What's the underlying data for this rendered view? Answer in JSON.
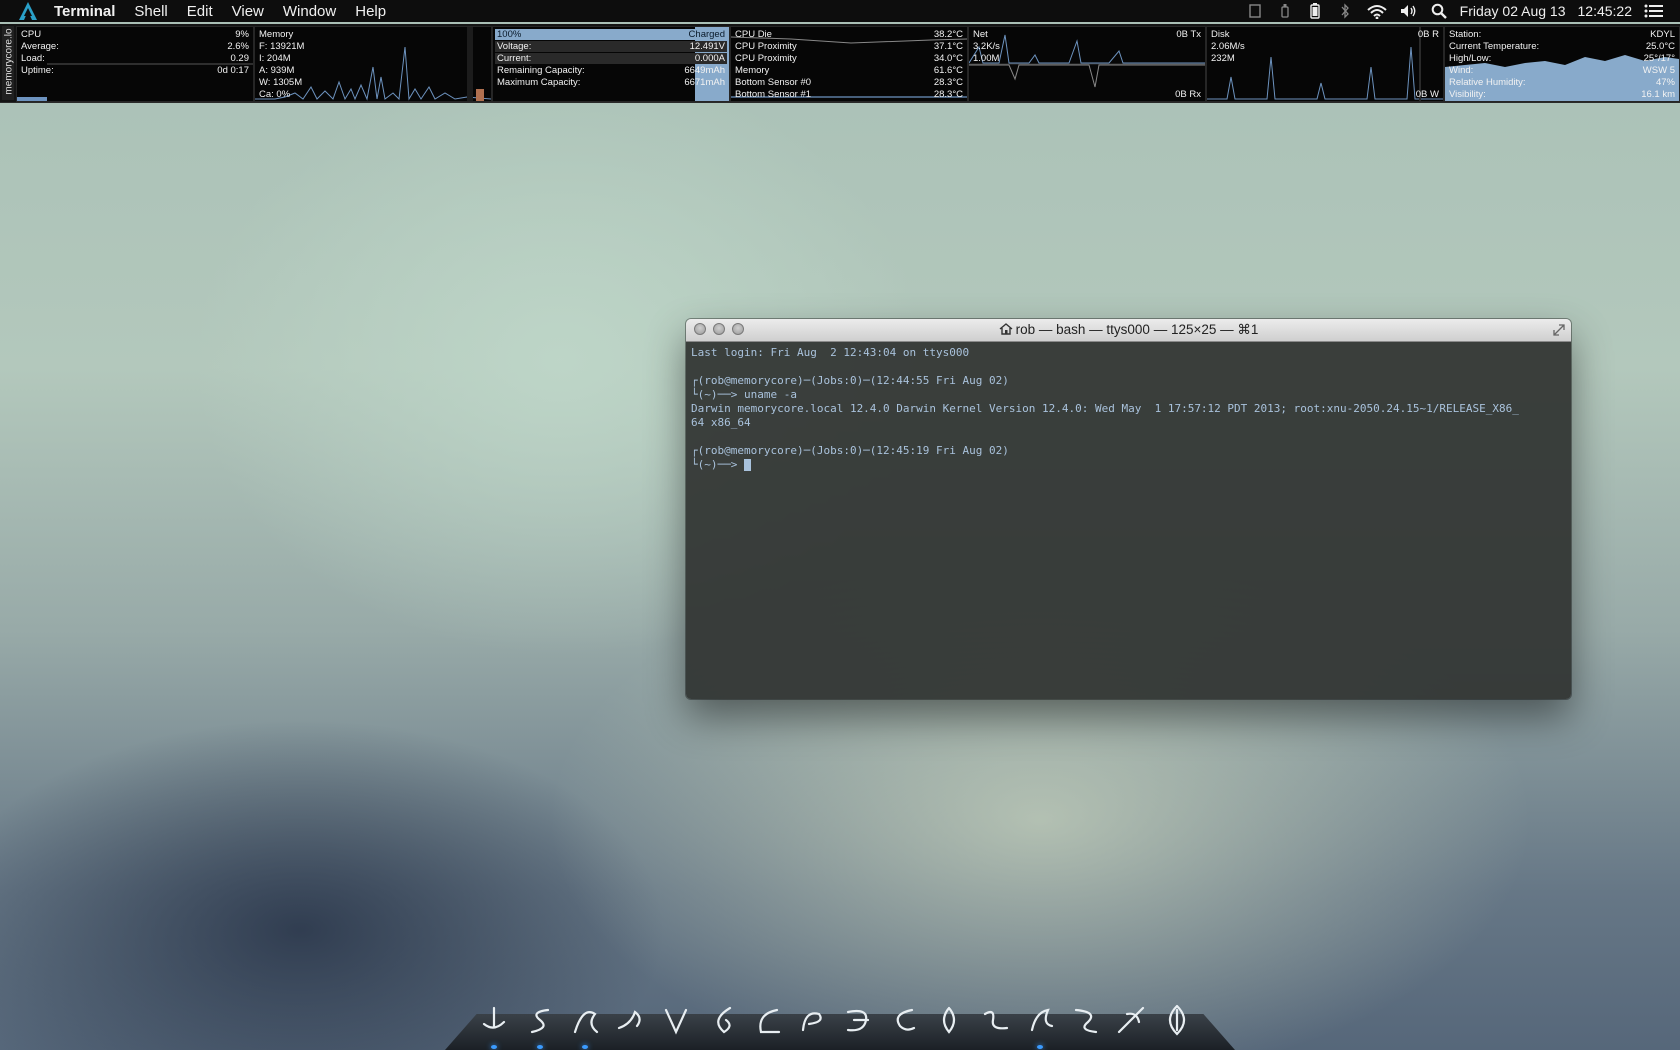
{
  "menubar": {
    "app_name": "Terminal",
    "menus": [
      "Shell",
      "Edit",
      "View",
      "Window",
      "Help"
    ],
    "date": "Friday 02 Aug 13",
    "time": "12:45:22",
    "status_icons": [
      "clipboard-icon",
      "power-icon",
      "battery-icon",
      "bluetooth-icon",
      "wifi-icon",
      "volume-icon",
      "spotlight-icon",
      "notification-center-icon"
    ]
  },
  "stats": {
    "host_label": "memorycore.lo",
    "cpu": {
      "title": "CPU",
      "value": "9%",
      "average_label": "Average:",
      "average": "2.6%",
      "load_label": "Load:",
      "load": "0.29",
      "uptime_label": "Uptime:",
      "uptime": "0d 0:17"
    },
    "memory": {
      "title": "Memory",
      "free": "F: 13921M",
      "inactive": "I: 204M",
      "active": "A: 939M",
      "wired": "W: 1305M",
      "cache": "Ca: 0%"
    },
    "battery": {
      "percent": "100%",
      "status": "Charged",
      "voltage_label": "Voltage:",
      "voltage": "12.491V",
      "current_label": "Current:",
      "current": "0.000A",
      "remaining_label": "Remaining Capacity:",
      "remaining": "6649mAh",
      "maximum_label": "Maximum Capacity:",
      "maximum": "6671mAh",
      "charge_fraction": 1.0
    },
    "temperature": {
      "rows": [
        {
          "label": "CPU Die",
          "value": "38.2°C"
        },
        {
          "label": "CPU Proximity",
          "value": "37.1°C"
        },
        {
          "label": "CPU Proximity",
          "value": "34.0°C"
        },
        {
          "label": "Memory",
          "value": "61.6°C"
        },
        {
          "label": "Bottom Sensor #0",
          "value": "28.3°C"
        },
        {
          "label": "Bottom Sensor #1",
          "value": "28.3°C"
        }
      ]
    },
    "net": {
      "title": "Net",
      "tx": "0B Tx",
      "rate": "3.2K/s",
      "total": "1.00M",
      "rx": "0B Rx"
    },
    "disk": {
      "title": "Disk",
      "read": "0B R",
      "rate": "2.06M/s",
      "total": "232M",
      "write": "0B W"
    },
    "weather": {
      "station_label": "Station:",
      "station": "KDYL",
      "current_temp_label": "Current Temperature:",
      "current_temp": "25.0°C",
      "high_low_label": "High/Low:",
      "high_low": "25°/17°",
      "wind_label": "Wind:",
      "wind": "WSW 5",
      "humidity_label": "Relative Humidity:",
      "humidity": "47%",
      "visibility_label": "Visibility:",
      "visibility": "16.1 km"
    }
  },
  "terminal": {
    "title": "rob — bash — ttys000 — 125×25 — ⌘1",
    "lines": [
      "Last login: Fri Aug  2 12:43:04 on ttys000",
      "",
      "┌(rob@memorycore)─(Jobs:0)─(12:44:55 Fri Aug 02)",
      "└(~)──> uname -a",
      "Darwin memorycore.local 12.4.0 Darwin Kernel Version 12.4.0: Wed May  1 17:57:12 PDT 2013; root:xnu-2050.24.15~1/RELEASE_X86_",
      "64 x86_64",
      "",
      "┌(rob@memorycore)─(Jobs:0)─(12:45:19 Fri Aug 02)",
      "└(~)──> "
    ],
    "text_color": "#a9c2dc"
  },
  "dock": {
    "items": [
      "finder-icon",
      "app-icon-2",
      "app-icon-3",
      "app-icon-4",
      "app-icon-5",
      "app-icon-6",
      "app-icon-7",
      "app-icon-8",
      "app-icon-9",
      "app-icon-10",
      "app-icon-11",
      "app-icon-12",
      "app-icon-13",
      "app-icon-14",
      "app-icon-15",
      "trash-icon"
    ],
    "running": [
      0,
      1,
      2,
      12
    ]
  },
  "colors": {
    "graph_blue": "#6d93bf",
    "battery_highlight": "#88aacb",
    "menubar": "#0d0d0d"
  }
}
